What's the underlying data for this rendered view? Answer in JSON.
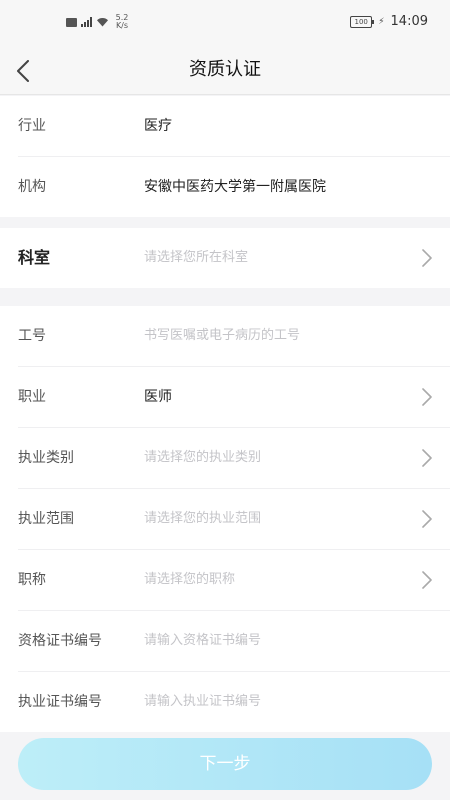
{
  "status_bar": {
    "net_speed": "5.2 K/s",
    "battery": "100",
    "time": "14:09"
  },
  "nav": {
    "title": "资质认证",
    "back_icon": "chevron-left-icon"
  },
  "section1": [
    {
      "label": "行业",
      "value": "医疗"
    },
    {
      "label": "机构",
      "value": "安徽中医药大学第一附属医院"
    }
  ],
  "section2": {
    "label": "科室",
    "placeholder": "请选择您所在科室"
  },
  "section3": {
    "employee_id": {
      "label": "工号",
      "placeholder": "书写医嘱或电子病历的工号"
    },
    "occupation": {
      "label": "职业",
      "value": "医师"
    },
    "practice_category": {
      "label": "执业类别",
      "placeholder": "请选择您的执业类别"
    },
    "practice_scope": {
      "label": "执业范围",
      "placeholder": "请选择您的执业范围"
    },
    "title": {
      "label": "职称",
      "placeholder": "请选择您的职称"
    },
    "qualification_cert": {
      "label": "资格证书编号",
      "placeholder": "请输入资格证书编号"
    },
    "practice_cert": {
      "label": "执业证书编号",
      "placeholder": "请输入执业证书编号"
    }
  },
  "next_button": {
    "label": "下一步"
  }
}
